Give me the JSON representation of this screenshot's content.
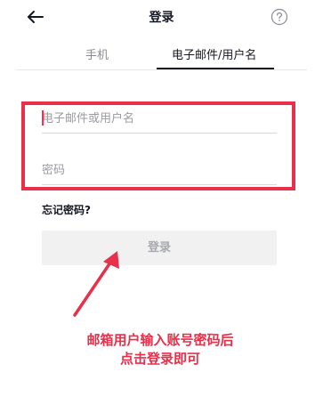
{
  "header": {
    "title": "登录",
    "back_icon": "arrow-left-icon",
    "help_icon": "question-circle-icon"
  },
  "tabs": [
    {
      "label": "手机",
      "active": false
    },
    {
      "label": "电子邮件/用户名",
      "active": true
    }
  ],
  "form": {
    "email_placeholder": "电子邮件或用户名",
    "email_value": "",
    "password_placeholder": "密码",
    "password_value": "",
    "forgot_password": "忘记密码?",
    "login_button": "登录"
  },
  "annotation": {
    "line1": "邮箱用户输入账号密码后",
    "line2": "点击登录即可",
    "color": "#e8304a"
  },
  "colors": {
    "highlight": "#e8304a",
    "caret": "#fe2c55",
    "button_bg": "#f1f1f2",
    "text_primary": "#161823",
    "text_secondary": "#8a8b91"
  }
}
